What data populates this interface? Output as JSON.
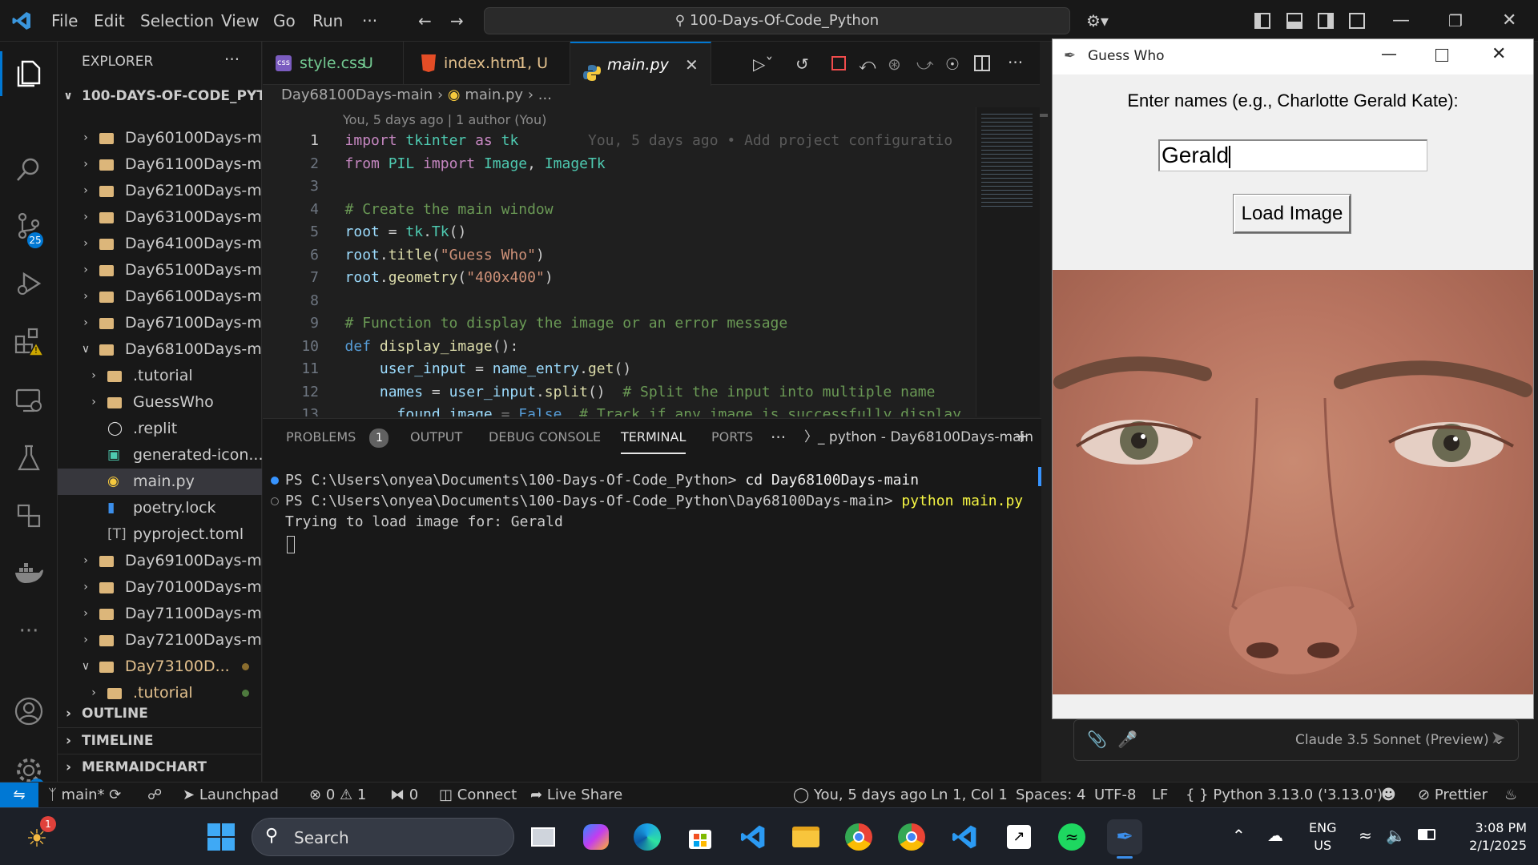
{
  "menu": [
    "File",
    "Edit",
    "Selection",
    "View",
    "Go",
    "Run",
    "···"
  ],
  "command_center": "100-Days-Of-Code_Python",
  "activity": {
    "source_control_badge": "25",
    "settings_badge": "1"
  },
  "explorer": {
    "title": "EXPLORER",
    "root": "100-DAYS-OF-CODE_PYTH...",
    "items": [
      {
        "label": "Day60100Days-m..."
      },
      {
        "label": "Day61100Days-m..."
      },
      {
        "label": "Day62100Days-m..."
      },
      {
        "label": "Day63100Days-m..."
      },
      {
        "label": "Day64100Days-m..."
      },
      {
        "label": "Day65100Days-m..."
      },
      {
        "label": "Day66100Days-m..."
      },
      {
        "label": "Day67100Days-m..."
      },
      {
        "label": "Day68100Days-m..."
      },
      {
        "label": ".tutorial"
      },
      {
        "label": "GuessWho"
      },
      {
        "label": ".replit"
      },
      {
        "label": "generated-icon...."
      },
      {
        "label": "main.py"
      },
      {
        "label": "poetry.lock"
      },
      {
        "label": "pyproject.toml"
      },
      {
        "label": "Day69100Days-m..."
      },
      {
        "label": "Day70100Days-m..."
      },
      {
        "label": "Day71100Days-m..."
      },
      {
        "label": "Day72100Days-m..."
      },
      {
        "label": "Day73100D..."
      },
      {
        "label": ".tutorial"
      }
    ],
    "sections": [
      "OUTLINE",
      "TIMELINE",
      "MERMAIDCHART"
    ]
  },
  "tabs": [
    {
      "name": "style.css",
      "status": "U"
    },
    {
      "name": "index.html",
      "status": "1, U"
    },
    {
      "name": "main.py",
      "status": ""
    }
  ],
  "breadcrumb": {
    "folder": "Day68100Days-main",
    "file": "main.py",
    "rest": "..."
  },
  "blame_header": "You, 5 days ago | 1 author (You)",
  "inline_blame": "You, 5 days ago • Add project configuratio",
  "code": [
    {
      "n": "1",
      "html": "<span style='color:#c586c0'>import</span> <span style='color:#4ec9b0'>tkinter</span> <span style='color:#c586c0'>as</span> <span style='color:#4ec9b0'>tk</span>"
    },
    {
      "n": "2",
      "html": "<span style='color:#c586c0'>from</span> <span style='color:#4ec9b0'>PIL</span> <span style='color:#c586c0'>import</span> <span style='color:#4ec9b0'>Image</span>, <span style='color:#4ec9b0'>ImageTk</span>"
    },
    {
      "n": "3",
      "html": ""
    },
    {
      "n": "4",
      "html": "<span style='color:#6a9955'># Create the main window</span>"
    },
    {
      "n": "5",
      "html": "<span style='color:#9cdcfe'>root</span> = <span style='color:#4ec9b0'>tk</span>.<span style='color:#4ec9b0'>Tk</span>()"
    },
    {
      "n": "6",
      "html": "<span style='color:#9cdcfe'>root</span>.<span style='color:#dcdcaa'>title</span>(<span style='color:#ce9178'>\"Guess Who\"</span>)"
    },
    {
      "n": "7",
      "html": "<span style='color:#9cdcfe'>root</span>.<span style='color:#dcdcaa'>geometry</span>(<span style='color:#ce9178'>\"400x400\"</span>)"
    },
    {
      "n": "8",
      "html": ""
    },
    {
      "n": "9",
      "html": "<span style='color:#6a9955'># Function to display the image or an error message</span>"
    },
    {
      "n": "10",
      "html": "<span style='color:#569cd6'>def</span> <span style='color:#dcdcaa'>display_image</span>():"
    },
    {
      "n": "11",
      "html": "    <span style='color:#9cdcfe'>user_input</span> = <span style='color:#9cdcfe'>name_entry</span>.<span style='color:#dcdcaa'>get</span>()"
    },
    {
      "n": "12",
      "html": "    <span style='color:#9cdcfe'>names</span> = <span style='color:#9cdcfe'>user_input</span>.<span style='color:#dcdcaa'>split</span>()  <span style='color:#6a9955'># Split the input into multiple name</span>"
    }
  ],
  "panel_tabs": [
    "PROBLEMS",
    "OUTPUT",
    "DEBUG CONSOLE",
    "TERMINAL",
    "PORTS"
  ],
  "problems_count": "1",
  "terminal_instance": "python - Day68100Days-main",
  "terminal": [
    {
      "prompt": "PS C:\\Users\\onyea\\Documents\\100-Days-Of-Code_Python> ",
      "cmd": "cd Day68100Days-main"
    },
    {
      "prompt": "PS C:\\Users\\onyea\\Documents\\100-Days-Of-Code_Python\\Day68100Days-main> ",
      "cmd": "python main.py"
    },
    {
      "prompt": "Trying to load image for: Gerald",
      "cmd": ""
    }
  ],
  "status": {
    "branch": "main*",
    "launchpad": "Launchpad",
    "errors": "0",
    "warnings": "1",
    "ports": "0",
    "connect": "Connect",
    "live_share": "Live Share",
    "blame": "You, 5 days ago",
    "position": "Ln 1, Col 1",
    "spaces": "Spaces: 4",
    "encoding": "UTF-8",
    "eol": "LF",
    "language": "Python",
    "python_version": "3.13.0 ('3.13.0')",
    "prettier": "Prettier"
  },
  "tk_window": {
    "title": "Guess Who",
    "prompt": "Enter names (e.g., Charlotte Gerald Kate):",
    "entry_value": "Gerald",
    "button": "Load Image"
  },
  "chat": {
    "model": "Claude 3.5 Sonnet (Preview)"
  },
  "taskbar": {
    "search": "Search",
    "lang1": "ENG",
    "lang2": "US",
    "time": "3:08 PM",
    "date": "2/1/2025",
    "notif_badge": "1"
  }
}
